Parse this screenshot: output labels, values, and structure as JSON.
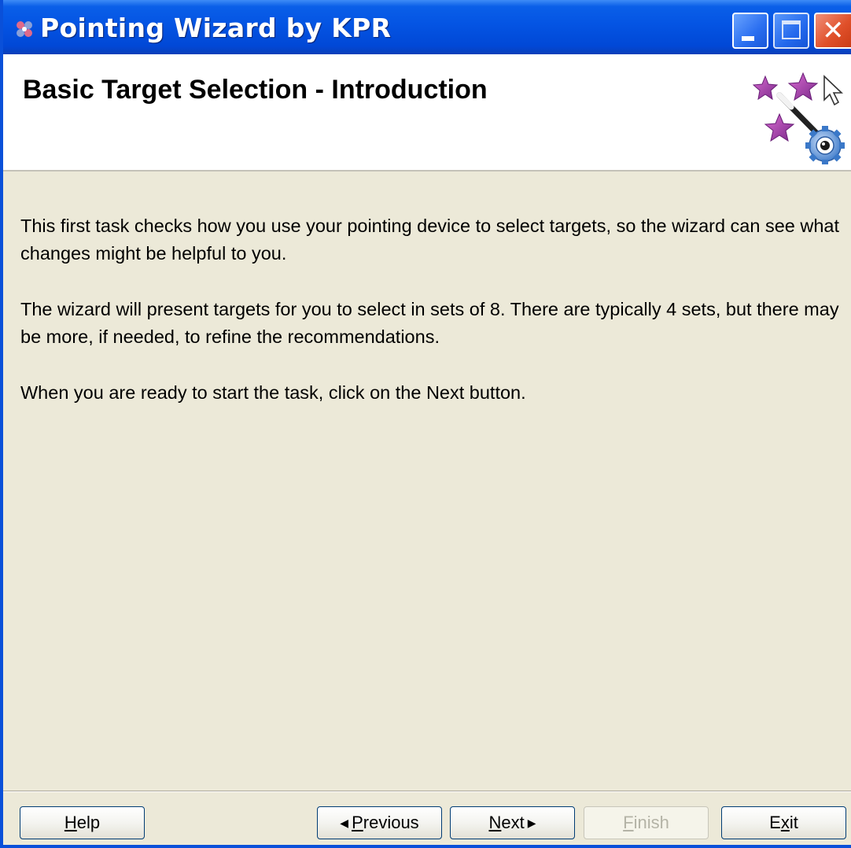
{
  "window": {
    "title": "Pointing Wizard by KPR",
    "controls": [
      "minimize",
      "maximize",
      "close"
    ]
  },
  "header": {
    "title": "Basic Target Selection - Introduction",
    "icon": "wizard-wand-stars-icon"
  },
  "content": {
    "paragraphs": [
      "This first task checks how you use your pointing device to select targets, so the wizard can see what changes might be helpful to you.",
      "The wizard will present targets for you to select in sets of 8. There are typically 4 sets, but there may be more, if needed, to refine the recommendations.",
      "When you are ready to start the task, click on the Next button."
    ]
  },
  "buttons": {
    "help": {
      "label": "Help",
      "mnemonic": "H",
      "rest": "elp"
    },
    "previous": {
      "label": "Previous",
      "mnemonic": "P",
      "rest": "revious"
    },
    "next": {
      "label": "Next",
      "mnemonic": "N",
      "rest": "ext"
    },
    "finish": {
      "label": "Finish",
      "mnemonic": "F",
      "rest": "inish",
      "enabled": false
    },
    "exit": {
      "label": "Exit",
      "pre": "E",
      "mnemonic": "x",
      "rest": "it"
    }
  },
  "colors": {
    "titlebar": "#0454e3",
    "dialog_bg": "#ece9d8",
    "header_bg": "#ffffff"
  }
}
